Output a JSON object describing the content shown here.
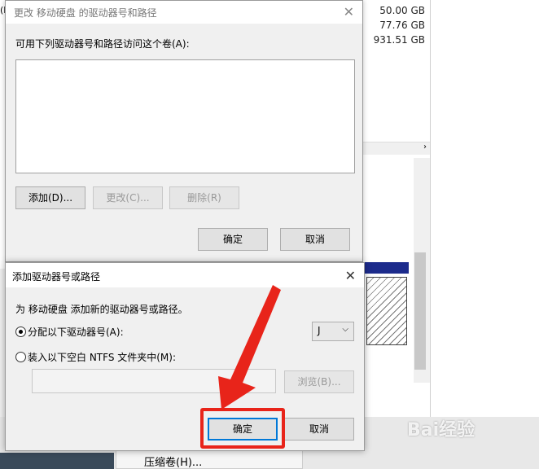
{
  "background": {
    "sizes": [
      "50.00 GB",
      "77.76 GB",
      "931.51 GB"
    ],
    "left_fragment": "(E",
    "context_menu_item": "压缩卷(H)...",
    "watermark": "Bai经验"
  },
  "dialog_change": {
    "title": "更改 移动硬盘 的驱动器号和路径",
    "list_label": "可用下列驱动器号和路径访问这个卷(A):",
    "add_button": "添加(D)...",
    "change_button": "更改(C)...",
    "remove_button": "删除(R)",
    "ok_button": "确定",
    "cancel_button": "取消"
  },
  "dialog_add": {
    "title": "添加驱动器号或路径",
    "description": "为 移动硬盘 添加新的驱动器号或路径。",
    "option_assign": "分配以下驱动器号(A):",
    "option_mount": "装入以下空白 NTFS 文件夹中(M):",
    "drive_letter": "J",
    "browse_button": "浏览(B)...",
    "ok_button": "确定",
    "cancel_button": "取消"
  },
  "colors": {
    "accent": "#0078d7",
    "annotation": "#e8241a",
    "volume_bar": "#1c2b8c"
  }
}
